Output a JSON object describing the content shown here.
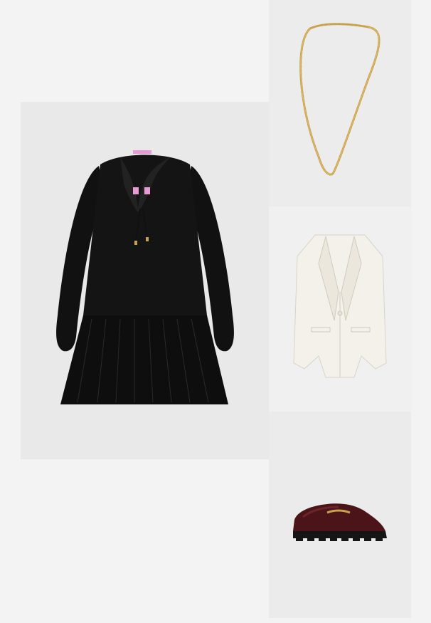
{
  "outfit": {
    "items": [
      {
        "id": "necklace",
        "name": "necklace",
        "icon": "gold-chain-necklace-icon",
        "color": "#c9a24e"
      },
      {
        "id": "dress",
        "name": "dress",
        "icon": "black-ruffle-dress-icon",
        "color": "#111111"
      },
      {
        "id": "blazer",
        "name": "blazer",
        "icon": "white-blazer-icon",
        "color": "#f4f1ea"
      },
      {
        "id": "loafers",
        "name": "loafers",
        "icon": "burgundy-loafer-icon",
        "color": "#4a1418"
      }
    ],
    "blazer_label_text": "",
    "dress_label_text": ""
  }
}
